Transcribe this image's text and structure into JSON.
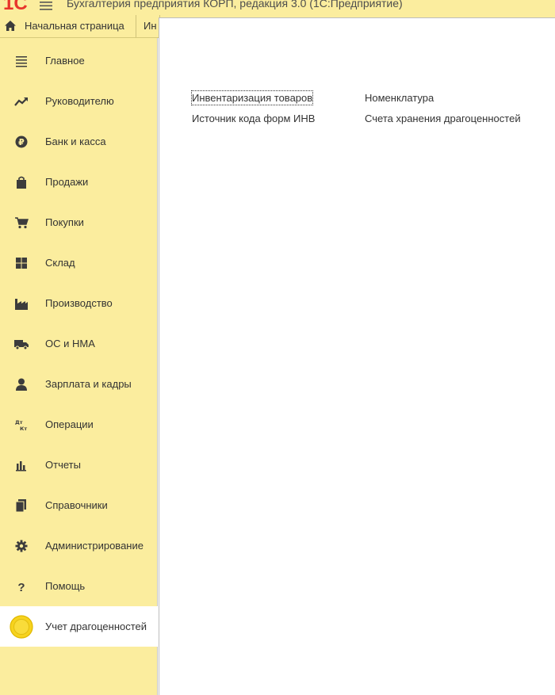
{
  "window": {
    "title": "Бухгалтерия предприятия КОРП, редакция 3.0  (1С:Предприятие)"
  },
  "tabs": [
    {
      "label": "Начальная страница",
      "icon": "home-icon"
    },
    {
      "label": "Ин"
    }
  ],
  "sidebar": {
    "items": [
      {
        "label": "Главное",
        "icon": "list-icon"
      },
      {
        "label": "Руководителю",
        "icon": "trend-up-icon"
      },
      {
        "label": "Банк и касса",
        "icon": "ruble-coin-icon"
      },
      {
        "label": "Продажи",
        "icon": "shopping-bag-icon"
      },
      {
        "label": "Покупки",
        "icon": "cart-icon"
      },
      {
        "label": "Склад",
        "icon": "warehouse-grid-icon"
      },
      {
        "label": "Производство",
        "icon": "factory-icon"
      },
      {
        "label": "ОС и НМА",
        "icon": "truck-icon"
      },
      {
        "label": "Зарплата и кадры",
        "icon": "person-icon"
      },
      {
        "label": "Операции",
        "icon": "debit-credit-icon"
      },
      {
        "label": "Отчеты",
        "icon": "bar-chart-icon"
      },
      {
        "label": "Справочники",
        "icon": "books-icon"
      },
      {
        "label": "Администрирование",
        "icon": "gear-icon"
      },
      {
        "label": "Помощь",
        "icon": "question-icon"
      },
      {
        "label": "Учет драгоценностей",
        "icon": "gold-coin-icon"
      }
    ],
    "active_index": 14
  },
  "content": {
    "links": [
      {
        "label": "Инвентаризация товаров"
      },
      {
        "label": "Номенклатура"
      },
      {
        "label": "Источник кода форм ИНВ"
      },
      {
        "label": "Счета хранения драгоценностей"
      }
    ]
  },
  "colors": {
    "panel": "#fbed9e",
    "logo_red": "#e8352b",
    "coin_gold": "#f7d31e",
    "icon_dark": "#3c3c3c"
  }
}
